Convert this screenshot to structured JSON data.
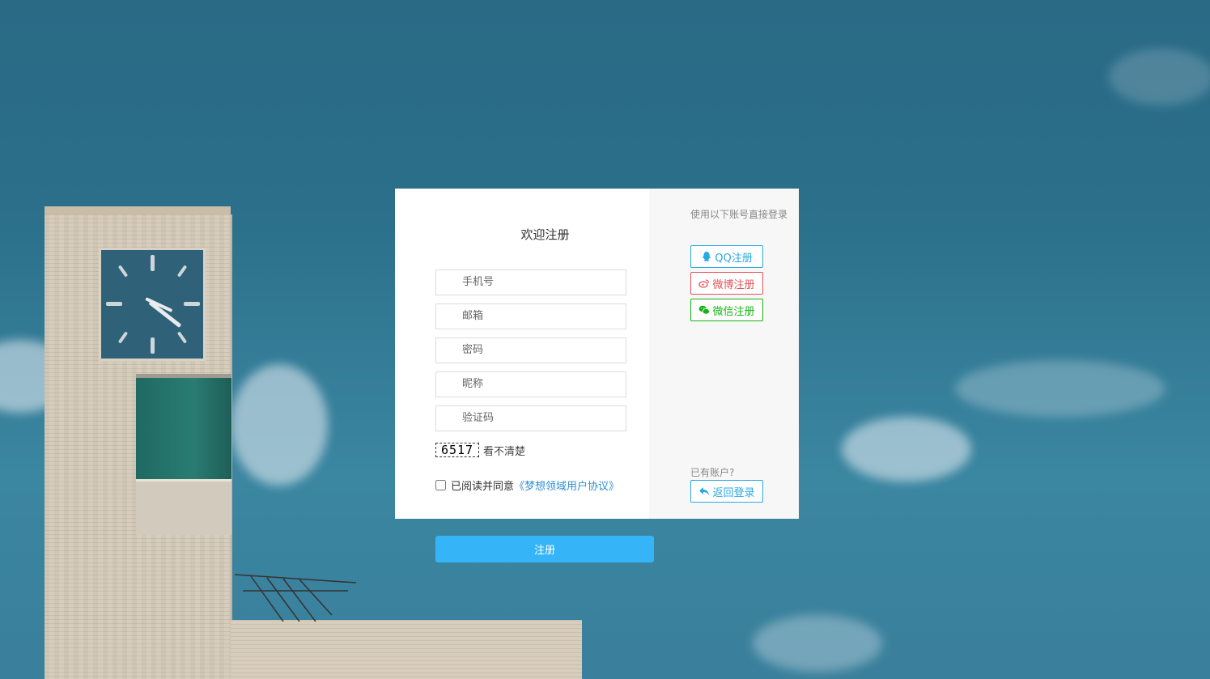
{
  "form": {
    "title": "欢迎注册",
    "phone_placeholder": "手机号",
    "email_placeholder": "邮箱",
    "password_placeholder": "密码",
    "nickname_placeholder": "昵称",
    "captcha_placeholder": "验证码",
    "captcha_code": "6517",
    "captcha_refresh": "看不清楚",
    "agree_text": "已阅读并同意",
    "agreement_link": "《梦想领域用户协议》",
    "submit_label": "注册"
  },
  "side": {
    "hint": "使用以下账号直接登录",
    "qq_label": "QQ注册",
    "weibo_label": "微博注册",
    "wechat_label": "微信注册",
    "has_account": "已有账户?",
    "back_label": "返回登录"
  },
  "colors": {
    "qq": "#29a9e1",
    "weibo": "#e2525c",
    "wechat": "#13b413",
    "primary": "#35b5f8"
  },
  "icons": {
    "qq": "qq-icon",
    "weibo": "weibo-icon",
    "wechat": "wechat-icon",
    "back": "reply-arrow-icon"
  }
}
